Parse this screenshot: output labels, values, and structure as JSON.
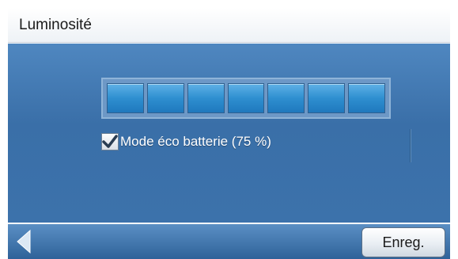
{
  "header": {
    "title": "Luminosité"
  },
  "brightness": {
    "level": 7,
    "max_level": 7
  },
  "eco_mode": {
    "checked": true,
    "label": "Mode éco batterie (75 %)"
  },
  "footer": {
    "back_icon": "back-arrow-icon",
    "save_label": "Enreg."
  },
  "colors": {
    "panel_blue": "#3c72ab",
    "segment_on": "#2e8fd0",
    "bar_blue": "#2f6299"
  }
}
